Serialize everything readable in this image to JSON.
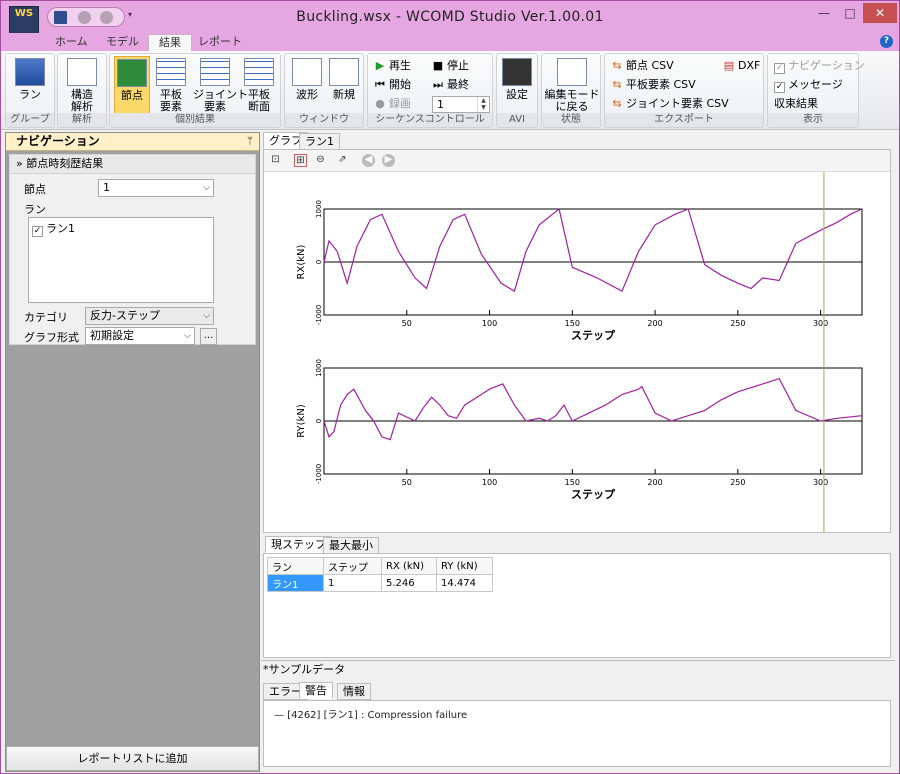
{
  "window": {
    "title": "Buckling.wsx - WCOMD Studio Ver.1.00.01",
    "app_icon": "WS",
    "minimize": "—",
    "maximize": "□",
    "close": "✕"
  },
  "ribbon_tabs": [
    "ホーム",
    "モデル",
    "結果",
    "レポート"
  ],
  "active_ribbon_tab": "結果",
  "help_icon": "?",
  "groups": {
    "group": {
      "label": "グループ",
      "run": "ラン"
    },
    "analysis": {
      "label": "解析",
      "structural": "構造\n解析"
    },
    "individual": {
      "label": "個別結果",
      "node": "節点",
      "plate": "平板\n要素",
      "joint": "ジョイント\n要素",
      "plate_section": "平板\n断面"
    },
    "window": {
      "label": "ウィンドウ",
      "waveform": "波形",
      "new": "新規"
    },
    "sequence": {
      "label": "シーケンスコントロール",
      "play": "再生",
      "stop": "停止",
      "start": "開始",
      "last": "最終",
      "record": "録画",
      "step_value": "1"
    },
    "avi": {
      "label": "AVI",
      "settings": "設定"
    },
    "state": {
      "label": "状態",
      "edit_mode": "編集モード\nに戻る"
    },
    "export": {
      "label": "エクスポート",
      "node_csv": "節点 CSV",
      "dxf": "DXF",
      "plate_csv": "平板要素 CSV",
      "joint_csv": "ジョイント要素 CSV"
    },
    "display": {
      "label": "表示",
      "navigation": "ナビゲーション",
      "message": "メッセージ",
      "convergence": "収束結果"
    }
  },
  "nav": {
    "header": "ナビゲーション",
    "pin": "ᛘ",
    "section": "節点時刻歴結果",
    "node_label": "節点",
    "node_value": "1",
    "run_label": "ラン",
    "runs": [
      {
        "label": "ラン1",
        "checked": true
      }
    ],
    "category_label": "カテゴリ",
    "category_value": "反力-ステップ",
    "graph_format_label": "グラフ形式",
    "graph_format_value": "初期設定",
    "dots": "...",
    "add_report": "レポートリストに追加"
  },
  "doc_tabs": [
    "グラフ",
    "ラン1"
  ],
  "graph_toolbar": [
    "⊡",
    "⊞",
    "⊖",
    "⇗",
    "◀",
    "▶"
  ],
  "chart_data": [
    {
      "type": "line",
      "ylabel": "RX(kN)",
      "xlabel": "ステップ",
      "xlim": [
        0,
        325
      ],
      "ylim": [
        -1000,
        1000
      ],
      "xticks": [
        50,
        100,
        150,
        200,
        250,
        300
      ],
      "yticks": [
        -1000,
        0,
        1000
      ],
      "cursor_x": 302,
      "x": [
        0,
        3,
        8,
        14,
        20,
        28,
        35,
        45,
        55,
        62,
        70,
        78,
        85,
        95,
        107,
        115,
        122,
        130,
        138,
        142,
        150,
        165,
        180,
        190,
        200,
        212,
        220,
        230,
        240,
        250,
        258,
        265,
        275,
        285,
        300,
        310,
        318,
        325
      ],
      "y": [
        0,
        400,
        200,
        -400,
        300,
        800,
        900,
        200,
        -300,
        -500,
        300,
        800,
        900,
        150,
        -400,
        -550,
        200,
        700,
        900,
        1000,
        -100,
        -300,
        -550,
        200,
        700,
        900,
        1000,
        -50,
        -250,
        -400,
        -500,
        -300,
        -350,
        350,
        600,
        750,
        900,
        1000
      ],
      "series": [
        {
          "color": "#a020a0"
        }
      ]
    },
    {
      "type": "line",
      "ylabel": "RY(kN)",
      "xlabel": "ステップ",
      "xlim": [
        0,
        325
      ],
      "ylim": [
        -1000,
        1000
      ],
      "xticks": [
        50,
        100,
        150,
        200,
        250,
        300
      ],
      "yticks": [
        -1000,
        0,
        1000
      ],
      "cursor_x": 302,
      "x": [
        0,
        3,
        6,
        10,
        14,
        18,
        25,
        30,
        35,
        40,
        45,
        55,
        60,
        65,
        70,
        75,
        80,
        85,
        95,
        100,
        108,
        115,
        122,
        130,
        135,
        140,
        145,
        150,
        160,
        170,
        180,
        190,
        192,
        200,
        210,
        215,
        220,
        230,
        240,
        250,
        260,
        270,
        275,
        285,
        300,
        310,
        325
      ],
      "y": [
        0,
        -300,
        -200,
        300,
        500,
        600,
        200,
        0,
        -300,
        -350,
        150,
        0,
        250,
        450,
        300,
        100,
        50,
        300,
        500,
        600,
        700,
        300,
        0,
        50,
        0,
        100,
        300,
        0,
        150,
        300,
        500,
        600,
        650,
        150,
        0,
        50,
        100,
        200,
        400,
        550,
        650,
        750,
        800,
        200,
        0,
        50,
        100
      ],
      "series": [
        {
          "color": "#a020a0"
        }
      ]
    }
  ],
  "table": {
    "tabs": [
      "現ステップ",
      "最大最小"
    ],
    "columns": [
      "ラン",
      "ステップ",
      "RX (kN)",
      "RY (kN)"
    ],
    "rows": [
      [
        "ラン1",
        "1",
        "5.246",
        "14.474"
      ]
    ]
  },
  "sample_label": "*サンプルデータ",
  "log": {
    "tabs": [
      "エラー",
      "警告",
      "情報"
    ],
    "active": "警告",
    "lines": [
      "[4262] [ラン1] : Compression failure"
    ]
  }
}
